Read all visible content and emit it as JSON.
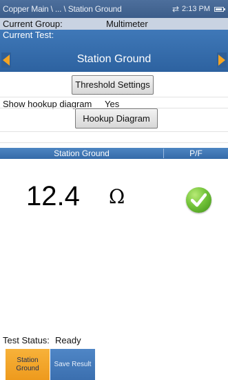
{
  "titlebar": {
    "title": "Copper Main \\ ... \\ Station Ground",
    "time": "2:13 PM",
    "sync_icon": "sync-arrows-icon",
    "battery_icon": "battery-icon"
  },
  "group": {
    "label": "Current Group:",
    "value": "Multimeter"
  },
  "test": {
    "label": "Current Test:",
    "name": "Station Ground"
  },
  "buttons": {
    "threshold": "Threshold Settings",
    "hookup": "Hookup Diagram"
  },
  "hookup": {
    "label": "Show hookup diagram",
    "value": "Yes"
  },
  "results": {
    "col_test": "Station Ground",
    "col_pf": "P/F",
    "reading": "12.4",
    "unit": "Ω",
    "pass_icon": "check-circle-icon",
    "pass_color": "#74c43a"
  },
  "status": {
    "label": "Test Status:",
    "value": "Ready"
  },
  "softkeys": {
    "station_line1": "Station",
    "station_line2": "Ground",
    "save": "Save Result"
  },
  "colors": {
    "accent_orange": "#f3a424",
    "header_blue": "#356aa8",
    "title_blue": "#4d6f9c"
  }
}
